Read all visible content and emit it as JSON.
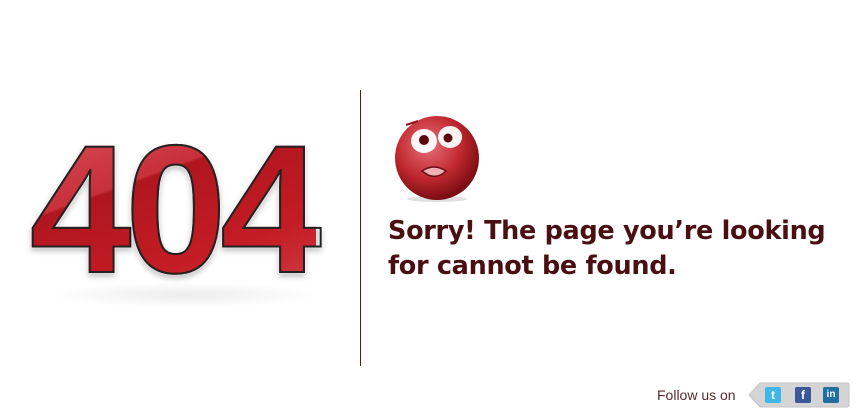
{
  "error": {
    "code": "404",
    "message_line1": "Sorry! The page you’re looking",
    "message_line2": "for cannot be found."
  },
  "footer": {
    "follow_label": "Follow us on",
    "social": [
      {
        "icon": "twitter-icon",
        "glyph": "t",
        "color": "#3fb8e8"
      },
      {
        "icon": "facebook-icon",
        "glyph": "f",
        "color": "#3b5998"
      },
      {
        "icon": "linkedin-icon",
        "glyph": "in",
        "color": "#1f6fa0"
      }
    ]
  },
  "colors": {
    "accent": "#c0202a",
    "text": "#4a0f12"
  }
}
